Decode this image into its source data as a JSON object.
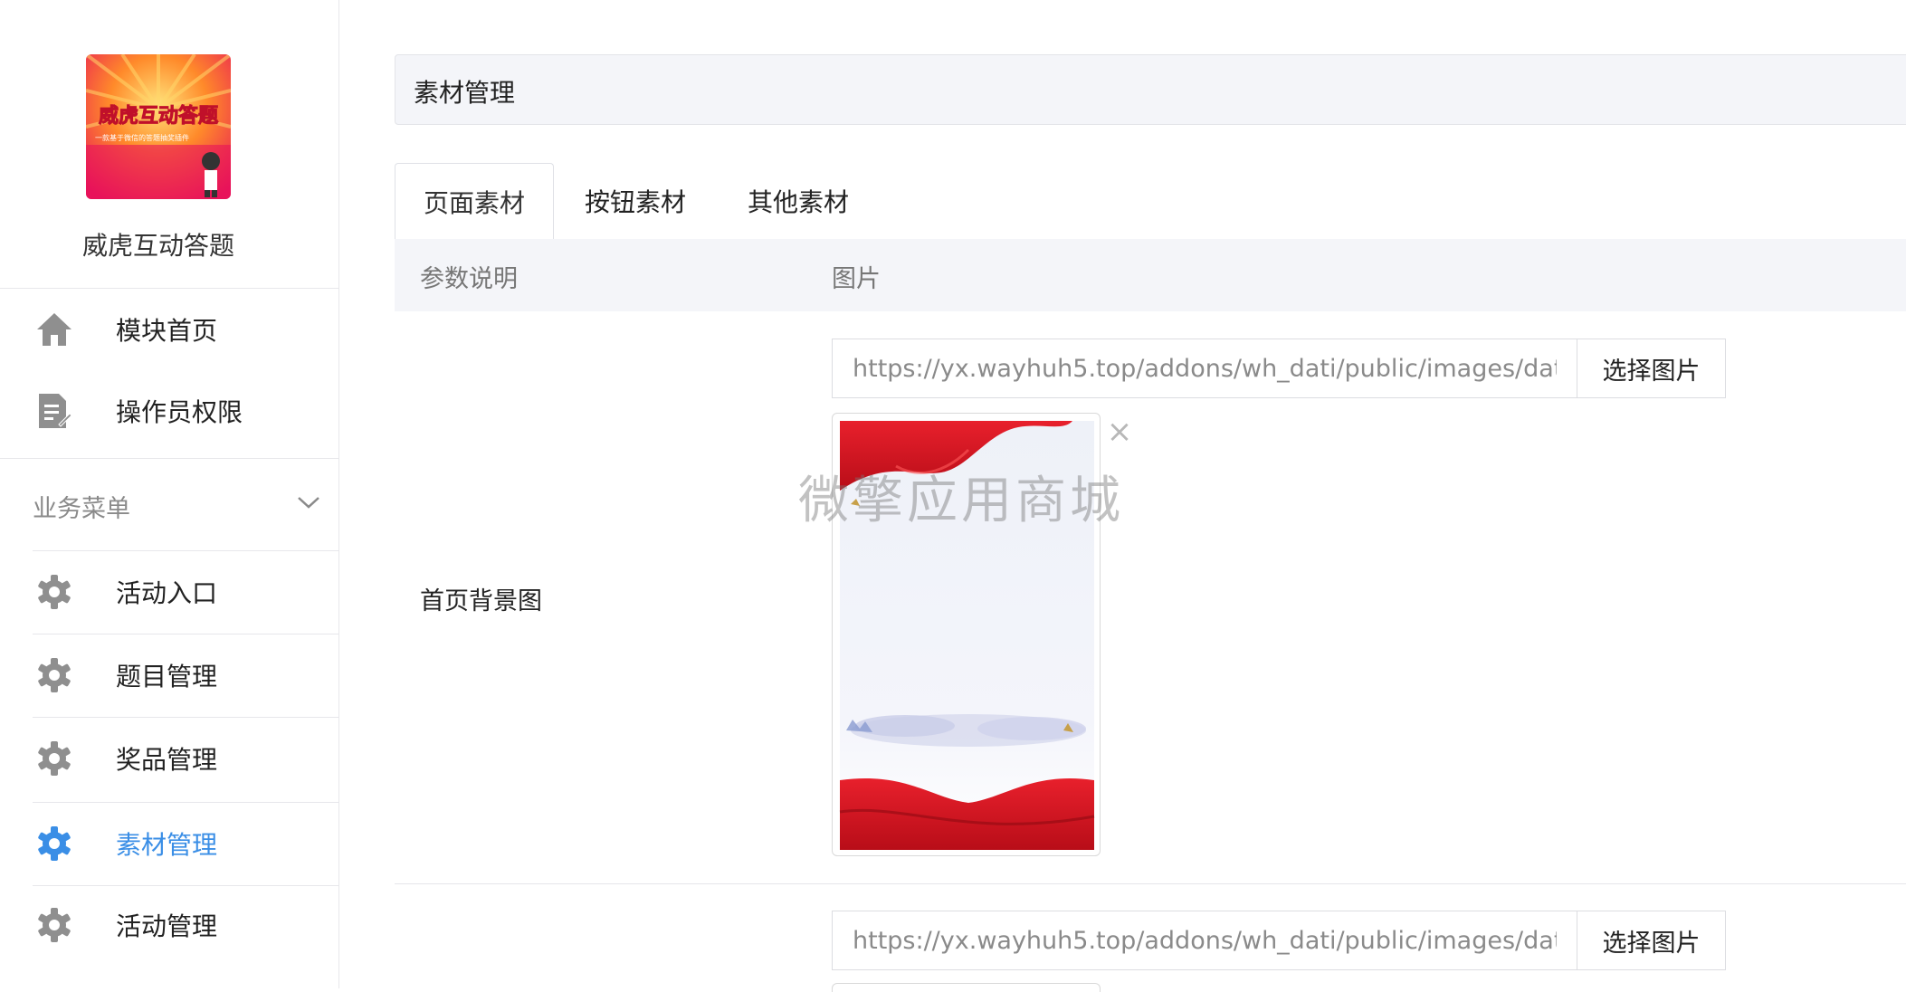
{
  "sidebar": {
    "logo": {
      "title_text": "威虎互动答题",
      "subtitle_text": "一款基于微信的答题抽奖插件"
    },
    "app_name": "威虎互动答题",
    "top_items": [
      {
        "label": "模块首页",
        "icon": "home-icon"
      },
      {
        "label": "操作员权限",
        "icon": "document-edit-icon"
      }
    ],
    "group": {
      "title": "业务菜单",
      "items": [
        {
          "label": "活动入口",
          "icon": "gear-icon",
          "active": false
        },
        {
          "label": "题目管理",
          "icon": "gear-icon",
          "active": false
        },
        {
          "label": "奖品管理",
          "icon": "gear-icon",
          "active": false
        },
        {
          "label": "素材管理",
          "icon": "gear-icon",
          "active": true
        },
        {
          "label": "活动管理",
          "icon": "gear-icon",
          "active": false
        }
      ]
    },
    "active_color": "#3a8ee6"
  },
  "main": {
    "title": "素材管理",
    "tabs": [
      {
        "label": "页面素材",
        "active": true
      },
      {
        "label": "按钮素材",
        "active": false
      },
      {
        "label": "其他素材",
        "active": false
      }
    ],
    "table_headers": [
      "参数说明",
      "图片"
    ],
    "rows": [
      {
        "label": "首页背景图",
        "url": "https://yx.wayhuh5.top/addons/wh_dati/public/images/dat",
        "button": "选择图片",
        "close_symbol": "×"
      },
      {
        "label": "",
        "url": "https://yx.wayhuh5.top/addons/wh_dati/public/images/dat",
        "button": "选择图片"
      }
    ],
    "watermark": "微擎应用商城"
  }
}
